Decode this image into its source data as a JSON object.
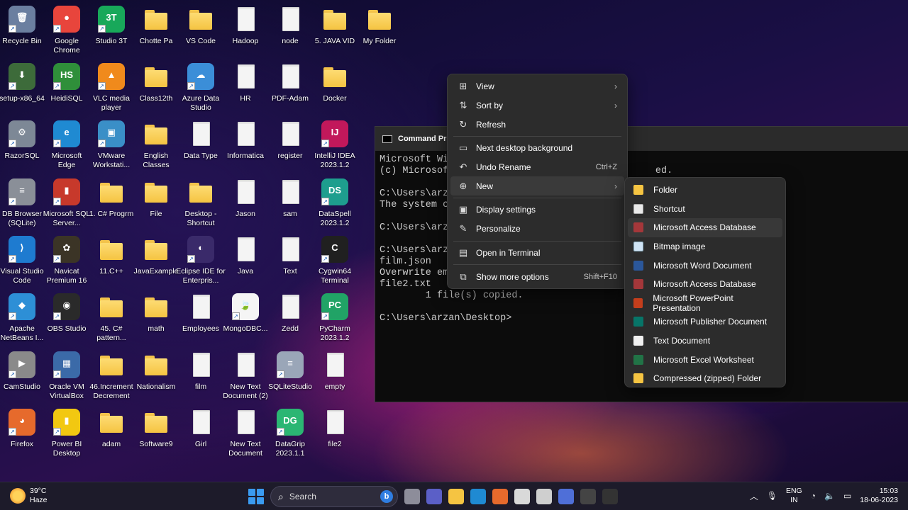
{
  "desktop": {
    "icons": [
      {
        "label": "Recycle Bin",
        "kind": "app",
        "color": "#6b7fa0",
        "glyph": "🗑"
      },
      {
        "label": "Google Chrome",
        "kind": "app",
        "color": "#e8453c",
        "glyph": "●"
      },
      {
        "label": "Studio 3T",
        "kind": "app",
        "color": "#18a85a",
        "glyph": "3T"
      },
      {
        "label": "Chotte Pa",
        "kind": "folder"
      },
      {
        "label": "VS Code",
        "kind": "folder"
      },
      {
        "label": "Hadoop",
        "kind": "doc"
      },
      {
        "label": "node",
        "kind": "doc"
      },
      {
        "label": "5. JAVA VID",
        "kind": "folder"
      },
      {
        "label": "My Folder",
        "kind": "folder"
      },
      {
        "label": "setup-x86_64",
        "kind": "app",
        "color": "#3d6b3a",
        "glyph": "⬇"
      },
      {
        "label": "HeidiSQL",
        "kind": "app",
        "color": "#2f8f3a",
        "glyph": "HS"
      },
      {
        "label": "VLC media player",
        "kind": "app",
        "color": "#f08a1c",
        "glyph": "▲"
      },
      {
        "label": "Class12th",
        "kind": "folder"
      },
      {
        "label": "Azure Data Studio",
        "kind": "app",
        "color": "#3b8ed8",
        "glyph": "☁"
      },
      {
        "label": "HR",
        "kind": "doc"
      },
      {
        "label": "PDF-Adam",
        "kind": "doc"
      },
      {
        "label": "Docker",
        "kind": "folder"
      },
      {
        "label": "RazorSQL",
        "kind": "app",
        "color": "#7d8896",
        "glyph": "⚙"
      },
      {
        "label": "Microsoft Edge",
        "kind": "app",
        "color": "#1f8ad2",
        "glyph": "e"
      },
      {
        "label": "VMware Workstati...",
        "kind": "app",
        "color": "#3a8fc7",
        "glyph": "▣"
      },
      {
        "label": "English Classes",
        "kind": "folder"
      },
      {
        "label": "Data Type",
        "kind": "doc"
      },
      {
        "label": "Informatica",
        "kind": "doc"
      },
      {
        "label": "register",
        "kind": "doc"
      },
      {
        "label": "IntelliJ IDEA 2023.1.2",
        "kind": "app",
        "color": "#c2185b",
        "glyph": "IJ"
      },
      {
        "label": "DB Browser (SQLite)",
        "kind": "app",
        "color": "#8a8f98",
        "glyph": "≡"
      },
      {
        "label": "Microsoft SQL Server...",
        "kind": "app",
        "color": "#c7392b",
        "glyph": "▮"
      },
      {
        "label": "1. C# Progrm",
        "kind": "folder"
      },
      {
        "label": "File",
        "kind": "folder"
      },
      {
        "label": "Desktop - Shortcut",
        "kind": "folder"
      },
      {
        "label": "Jason",
        "kind": "doc"
      },
      {
        "label": "sam",
        "kind": "doc"
      },
      {
        "label": "DataSpell 2023.1.2",
        "kind": "app",
        "color": "#1e9e8e",
        "glyph": "DS"
      },
      {
        "label": "Visual Studio Code",
        "kind": "app",
        "color": "#1e7bd0",
        "glyph": "⟩"
      },
      {
        "label": "Navicat Premium 16",
        "kind": "app",
        "color": "#3b3426",
        "glyph": "✿"
      },
      {
        "label": "11.C++",
        "kind": "folder"
      },
      {
        "label": "JavaExample",
        "kind": "folder"
      },
      {
        "label": "Eclipse IDE for Enterpris...",
        "kind": "app",
        "color": "#3a2a6a",
        "glyph": "◐"
      },
      {
        "label": "Java",
        "kind": "doc"
      },
      {
        "label": "Text",
        "kind": "doc"
      },
      {
        "label": "Cygwin64 Terminal",
        "kind": "app",
        "color": "#202020",
        "glyph": "C"
      },
      {
        "label": "Apache NetBeans I...",
        "kind": "app",
        "color": "#2d8fd6",
        "glyph": "◆"
      },
      {
        "label": "OBS Studio",
        "kind": "app",
        "color": "#2a2a2a",
        "glyph": "◉"
      },
      {
        "label": "45. C# pattern...",
        "kind": "folder"
      },
      {
        "label": "math",
        "kind": "folder"
      },
      {
        "label": "Employees",
        "kind": "doc"
      },
      {
        "label": "MongoDBC...",
        "kind": "app",
        "color": "#f5f5f5",
        "glyph": "🍃"
      },
      {
        "label": "Zedd",
        "kind": "doc"
      },
      {
        "label": "PyCharm 2023.1.2",
        "kind": "app",
        "color": "#21a366",
        "glyph": "PC"
      },
      {
        "label": "CamStudio",
        "kind": "app",
        "color": "#8a8a8a",
        "glyph": "▶"
      },
      {
        "label": "Oracle VM VirtualBox",
        "kind": "app",
        "color": "#3b6aa8",
        "glyph": "▦"
      },
      {
        "label": "46.Increment Decrement",
        "kind": "folder"
      },
      {
        "label": "Nationalism",
        "kind": "folder"
      },
      {
        "label": "film",
        "kind": "doc"
      },
      {
        "label": "New Text Document (2)",
        "kind": "doc"
      },
      {
        "label": "SQLiteStudio",
        "kind": "app",
        "color": "#9aa6b8",
        "glyph": "≡"
      },
      {
        "label": "empty",
        "kind": "doc"
      },
      {
        "label": "Firefox",
        "kind": "app",
        "color": "#e66a2c",
        "glyph": "◕"
      },
      {
        "label": "Power BI Desktop",
        "kind": "app",
        "color": "#f2c811",
        "glyph": "▮"
      },
      {
        "label": "adam",
        "kind": "folder"
      },
      {
        "label": "Software9",
        "kind": "folder"
      },
      {
        "label": "Girl",
        "kind": "doc"
      },
      {
        "label": "New Text Document",
        "kind": "doc"
      },
      {
        "label": "DataGrip 2023.1.1",
        "kind": "app",
        "color": "#2bb673",
        "glyph": "DG"
      },
      {
        "label": "file2",
        "kind": "doc"
      }
    ]
  },
  "cmd": {
    "title": "Command Pro",
    "lines": [
      "Microsoft Wi",
      "(c) Microsof                                    ed.",
      "",
      "C:\\Users\\arz",
      "The system c",
      "",
      "C:\\Users\\arz",
      "",
      "C:\\Users\\arz",
      "film.json",
      "Overwrite em",
      "file2.txt",
      "        1 file(s) copied.",
      "",
      "C:\\Users\\arzan\\Desktop>"
    ]
  },
  "context_menu": {
    "items": [
      {
        "label": "View",
        "icon": "grid-icon",
        "glyph": "⊞",
        "arrow": "›",
        "shortcut": ""
      },
      {
        "label": "Sort by",
        "icon": "sort-icon",
        "glyph": "⇅",
        "arrow": "›",
        "shortcut": ""
      },
      {
        "label": "Refresh",
        "icon": "refresh-icon",
        "glyph": "↻",
        "arrow": "",
        "shortcut": ""
      },
      {
        "sep": true
      },
      {
        "label": "Next desktop background",
        "icon": "wallpaper-icon",
        "glyph": "▭",
        "arrow": "",
        "shortcut": ""
      },
      {
        "label": "Undo Rename",
        "icon": "undo-icon",
        "glyph": "↶",
        "arrow": "",
        "shortcut": "Ctrl+Z"
      },
      {
        "label": "New",
        "icon": "new-icon",
        "glyph": "⊕",
        "arrow": "›",
        "shortcut": "",
        "active": true
      },
      {
        "sep": true
      },
      {
        "label": "Display settings",
        "icon": "display-icon",
        "glyph": "▣",
        "arrow": "",
        "shortcut": ""
      },
      {
        "label": "Personalize",
        "icon": "brush-icon",
        "glyph": "✎",
        "arrow": "",
        "shortcut": ""
      },
      {
        "sep": true
      },
      {
        "label": "Open in Terminal",
        "icon": "terminal-icon",
        "glyph": "▤",
        "arrow": "",
        "shortcut": ""
      },
      {
        "sep": true
      },
      {
        "label": "Show more options",
        "icon": "more-options-icon",
        "glyph": "⧉",
        "arrow": "",
        "shortcut": "Shift+F10"
      }
    ]
  },
  "new_submenu": {
    "items": [
      {
        "label": "Folder",
        "icon": "ic-folder"
      },
      {
        "label": "Shortcut",
        "icon": "ic-short"
      },
      {
        "label": "Microsoft Access Database",
        "icon": "ic-access",
        "hover": true
      },
      {
        "label": "Bitmap image",
        "icon": "ic-bmp"
      },
      {
        "label": "Microsoft Word Document",
        "icon": "ic-word"
      },
      {
        "label": "Microsoft Access Database",
        "icon": "ic-access"
      },
      {
        "label": "Microsoft PowerPoint Presentation",
        "icon": "ic-ppt"
      },
      {
        "label": "Microsoft Publisher Document",
        "icon": "ic-pub"
      },
      {
        "label": "Text Document",
        "icon": "ic-txt"
      },
      {
        "label": "Microsoft Excel Worksheet",
        "icon": "ic-excel"
      },
      {
        "label": "Compressed (zipped) Folder",
        "icon": "ic-zip"
      }
    ]
  },
  "taskbar": {
    "weather_temp": "39°C",
    "weather_desc": "Haze",
    "search_placeholder": "Search",
    "apps": [
      {
        "name": "taskview-icon",
        "color": "#8d8d9a"
      },
      {
        "name": "teams-icon",
        "color": "#5b5fc7"
      },
      {
        "name": "file-explorer-icon",
        "color": "#f5c442"
      },
      {
        "name": "edge-icon",
        "color": "#1f8ad2"
      },
      {
        "name": "firefox-icon",
        "color": "#e66a2c"
      },
      {
        "name": "store-icon",
        "color": "#d9d9d9"
      },
      {
        "name": "unity-icon",
        "color": "#cfcfcf"
      },
      {
        "name": "vscode-like-icon",
        "color": "#4f6fd8"
      },
      {
        "name": "obs-icon",
        "color": "#444444"
      },
      {
        "name": "terminal-icon",
        "color": "#333333"
      }
    ],
    "language_line1": "ENG",
    "language_line2": "IN",
    "time": "15:03",
    "date": "18-06-2023"
  }
}
